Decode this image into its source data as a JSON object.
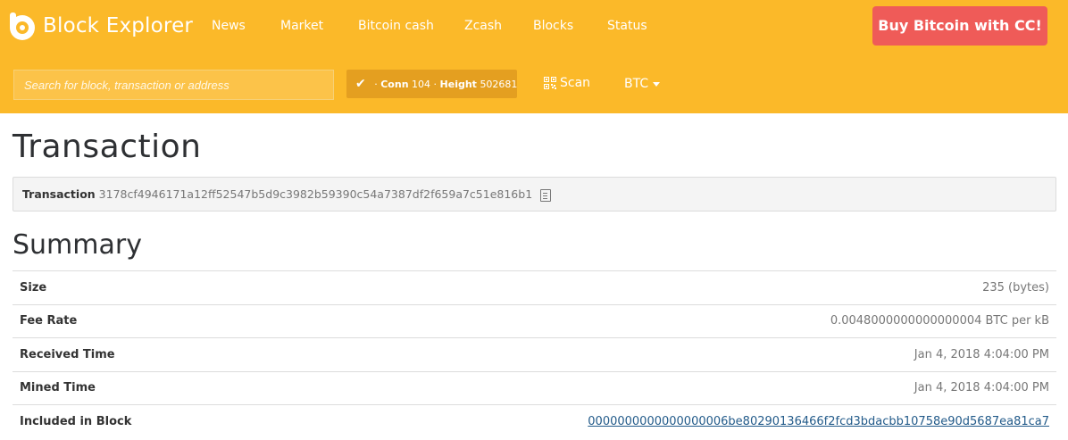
{
  "brand": {
    "name": "Block Explorer",
    "logo_icon": "block-explorer-logo-icon"
  },
  "nav": {
    "items": [
      {
        "label": "News"
      },
      {
        "label": "Market"
      },
      {
        "label": "Bitcoin cash"
      },
      {
        "label": "Zcash"
      },
      {
        "label": "Blocks"
      },
      {
        "label": "Status"
      }
    ]
  },
  "buy_button": {
    "label": "Buy Bitcoin with CC!",
    "color": "#ef5b58"
  },
  "search": {
    "placeholder": "Search for block, transaction or address",
    "value": ""
  },
  "status": {
    "icon": "check-icon",
    "conn_label": "Conn",
    "conn_value": "104",
    "height_label": "Height",
    "height_value": "502681"
  },
  "scan": {
    "label": "Scan",
    "icon": "qr-code-icon"
  },
  "currency": {
    "selected": "BTC"
  },
  "page_title": "Transaction",
  "transaction": {
    "label": "Transaction",
    "hash": "3178cf4946171a12ff52547b5d9c3982b59390c54a7387df2f659a7c51e816b1",
    "copy_icon": "copy-icon"
  },
  "summary": {
    "title": "Summary",
    "rows": [
      {
        "key": "Size",
        "value": "235 (bytes)"
      },
      {
        "key": "Fee Rate",
        "value": "0.0048000000000000004 BTC per kB"
      },
      {
        "key": "Received Time",
        "value": "Jan 4, 2018 4:04:00 PM"
      },
      {
        "key": "Mined Time",
        "value": "Jan 4, 2018 4:04:00 PM"
      },
      {
        "key": "Included in Block",
        "value": "0000000000000000006be80290136466f2fcd3bdacbb10758e90d5687ea81ca7"
      }
    ]
  },
  "colors": {
    "header": "#fbb929",
    "link": "#235b8a"
  }
}
